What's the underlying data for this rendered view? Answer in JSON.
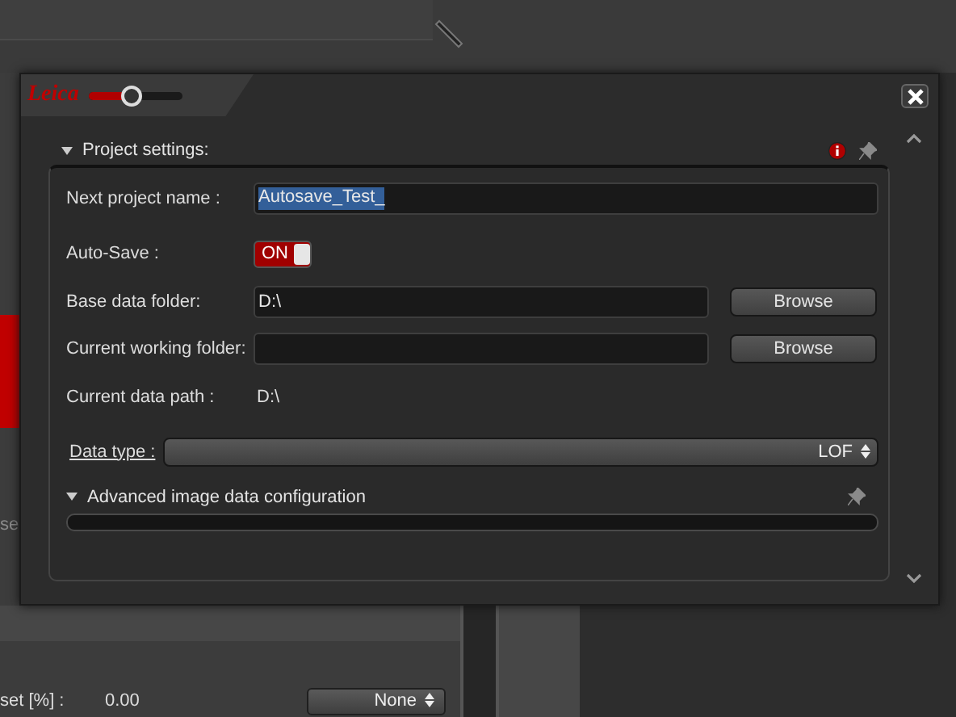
{
  "background_app": {
    "cut_label": "se",
    "offset_label": "set [%] :",
    "offset_value": "0.00",
    "dropdown": "None"
  },
  "dialog": {
    "logo": "Leica",
    "zoom_slider": {
      "level": 0.45
    },
    "section": {
      "title": "Project settings:",
      "expanded": true,
      "fields": [
        {
          "kind": "text",
          "label": "Next project name :",
          "value": "Autosave_Test_",
          "highlighted": true
        },
        {
          "kind": "toggle",
          "label": "Auto-Save :",
          "value": "ON",
          "on": true
        },
        {
          "kind": "folder",
          "label": "Base data folder:",
          "value": "D:\\",
          "button": "Browse"
        },
        {
          "kind": "folder",
          "label": "Current working folder:",
          "button": "Browse"
        },
        {
          "kind": "static",
          "label": "Current data path :",
          "value": "D:\\"
        },
        {
          "kind": "select",
          "label": "Data type :",
          "value": "LOF"
        }
      ],
      "subsection": {
        "title": "Advanced image data configuration",
        "expanded": true
      }
    }
  }
}
